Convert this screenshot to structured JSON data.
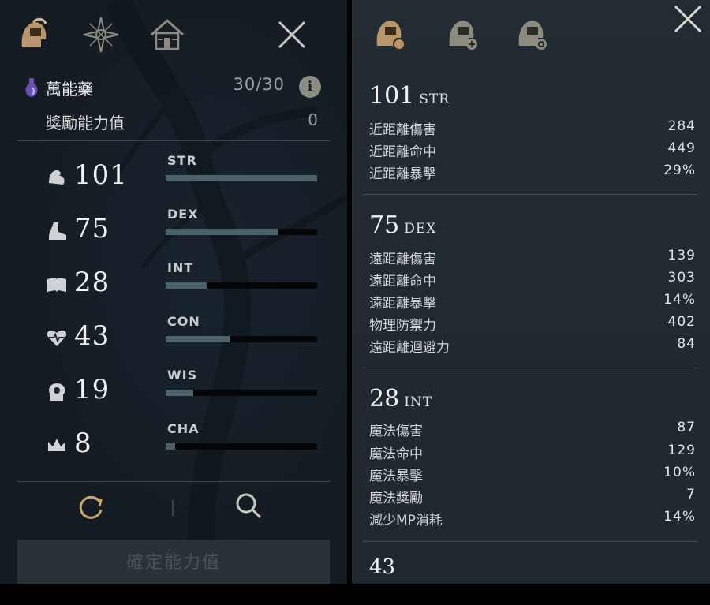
{
  "left_panel": {
    "tabs": [
      {
        "name": "character-tab",
        "icon": "helmet-gold-icon",
        "active": true
      },
      {
        "name": "constellation-tab",
        "icon": "compass-star-icon",
        "active": false
      },
      {
        "name": "house-tab",
        "icon": "house-icon",
        "active": false
      }
    ],
    "potion": {
      "name": "萬能藥",
      "count": "30/30",
      "info_label": "i",
      "icon": "potion-icon"
    },
    "bonus": {
      "label": "獎勵能力值",
      "value": "0"
    },
    "stats": [
      {
        "abbr": "STR",
        "value": "101",
        "icon": "bicep-icon",
        "fill": 1.0
      },
      {
        "abbr": "DEX",
        "value": "75",
        "icon": "boot-icon",
        "fill": 0.74
      },
      {
        "abbr": "INT",
        "value": "28",
        "icon": "book-icon",
        "fill": 0.27
      },
      {
        "abbr": "CON",
        "value": "43",
        "icon": "heart-icon",
        "fill": 0.42
      },
      {
        "abbr": "WIS",
        "value": "19",
        "icon": "head-icon",
        "fill": 0.18
      },
      {
        "abbr": "CHA",
        "value": "8",
        "icon": "crown-icon",
        "fill": 0.06
      }
    ],
    "actions": {
      "reset_icon": "reset-icon",
      "search_icon": "search-icon"
    },
    "confirm_label": "確定能力值"
  },
  "right_panel": {
    "tabs": [
      {
        "name": "stats-gear-tab",
        "icon": "helmet-gear-icon",
        "active": true
      },
      {
        "name": "stats-plus-tab",
        "icon": "helmet-plus-icon",
        "active": false
      },
      {
        "name": "stats-target-tab",
        "icon": "helmet-target-icon",
        "active": false
      }
    ],
    "sections": [
      {
        "value": "101",
        "abbr": "STR",
        "rows": [
          {
            "label": "近距離傷害",
            "value": "284"
          },
          {
            "label": "近距離命中",
            "value": "449"
          },
          {
            "label": "近距離暴擊",
            "value": "29%"
          }
        ]
      },
      {
        "value": "75",
        "abbr": "DEX",
        "rows": [
          {
            "label": "遠距離傷害",
            "value": "139"
          },
          {
            "label": "遠距離命中",
            "value": "303"
          },
          {
            "label": "遠距離暴擊",
            "value": "14%"
          },
          {
            "label": "物理防禦力",
            "value": "402"
          },
          {
            "label": "遠距離迴避力",
            "value": "84"
          }
        ]
      },
      {
        "value": "28",
        "abbr": "INT",
        "rows": [
          {
            "label": "魔法傷害",
            "value": "87"
          },
          {
            "label": "魔法命中",
            "value": "129"
          },
          {
            "label": "魔法暴擊",
            "value": "10%"
          },
          {
            "label": "魔法獎勵",
            "value": "7"
          },
          {
            "label": "減少MP消耗",
            "value": "14%"
          }
        ]
      }
    ],
    "next_section_value": "43"
  },
  "colors": {
    "gold": "#c9a86a",
    "bar_fill": "#4a6268",
    "panel_bg": "#1c242c"
  }
}
